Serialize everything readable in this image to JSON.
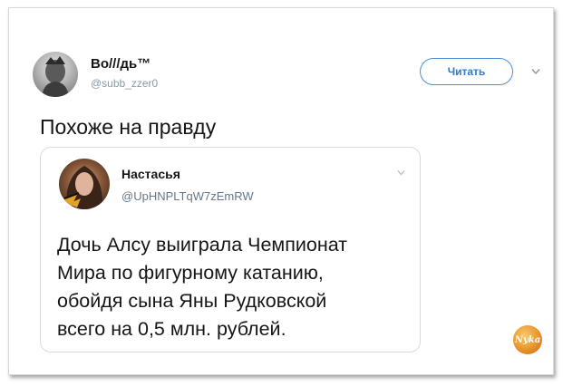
{
  "tweet": {
    "author_name": "Bo///дь™",
    "author_handle": "@subb_zzer0",
    "follow_label": "Читать",
    "text": "Похоже на правду"
  },
  "quoted": {
    "author_name": "Настасья",
    "author_handle": "@UpHNPLTqW7zEmRW",
    "lines": [
      "Дочь Алсу выиграла Чемпионат",
      "Мира по фигурному катанию,",
      "обойдя сына Яны Рудковской",
      "всего на 0,5 млн. рублей."
    ]
  },
  "watermark": {
    "text": "Nyka"
  },
  "colors": {
    "accent": "#2b7bd3",
    "text": "#14171a",
    "muted": "#8899a6"
  }
}
